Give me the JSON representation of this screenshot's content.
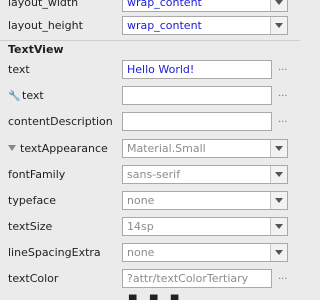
{
  "layout": {
    "width_label": "layout_width",
    "width_value": "wrap_content",
    "height_label": "layout_height",
    "height_value": "wrap_content"
  },
  "textview": {
    "section_title": "TextView",
    "properties": {
      "text": {
        "label": "text",
        "value": "Hello World!"
      },
      "tools_text": {
        "label": "text",
        "value": "",
        "icon": "wrench-icon"
      },
      "content_description": {
        "label": "contentDescription",
        "value": ""
      },
      "text_appearance": {
        "label": "textAppearance",
        "value": "Material.Small"
      },
      "font_family": {
        "label": "fontFamily",
        "value": "sans-serif"
      },
      "typeface": {
        "label": "typeface",
        "value": "none"
      },
      "text_size": {
        "label": "textSize",
        "value": "14sp"
      },
      "line_spacing_extra": {
        "label": "lineSpacingExtra",
        "value": "none"
      },
      "text_color": {
        "label": "textColor",
        "value": "?attr/textColorTertiary"
      }
    }
  },
  "more_button_label": "...",
  "colors": {
    "panel_bg": "#ebebeb",
    "value_blue": "#1c1cd6",
    "value_grey": "#8c8c8c"
  }
}
